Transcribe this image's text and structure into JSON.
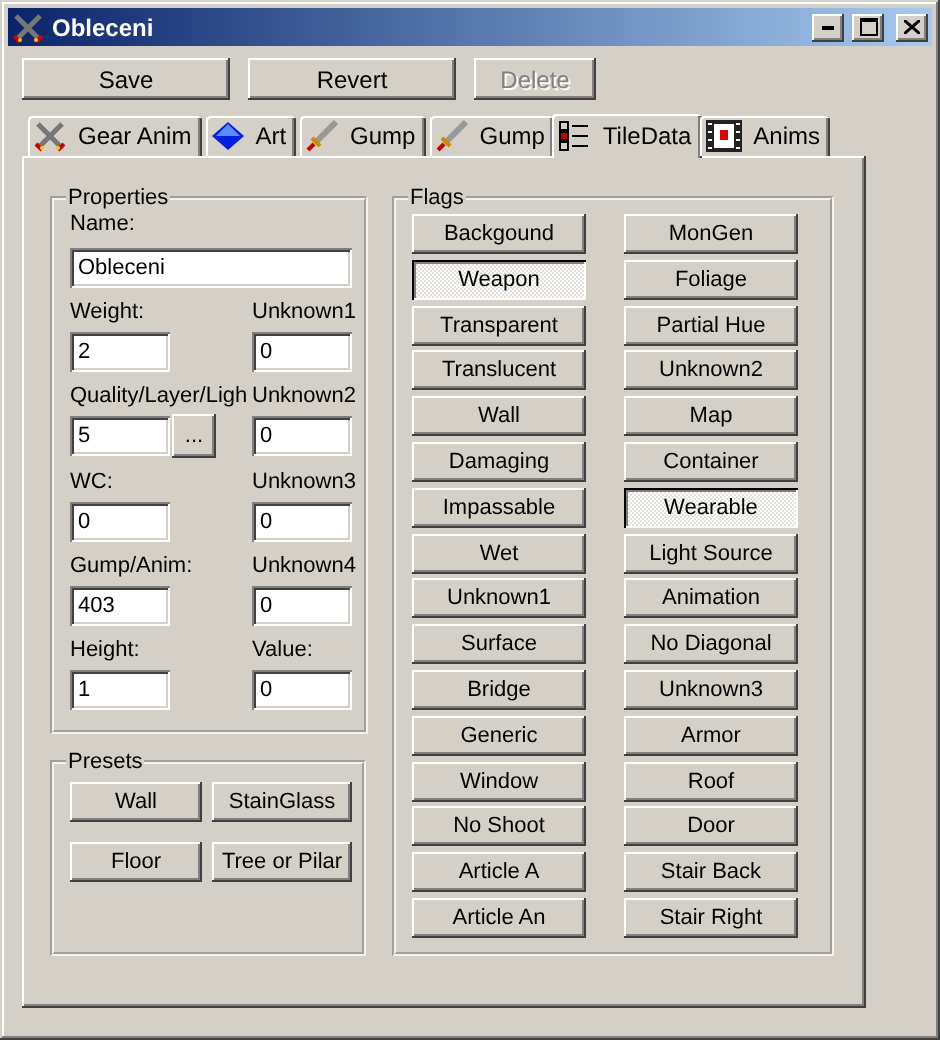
{
  "window": {
    "title": "Obleceni"
  },
  "toolbar": [
    {
      "label": "Save",
      "disabled": false
    },
    {
      "label": "Revert",
      "disabled": false
    },
    {
      "label": "Delete",
      "disabled": true
    }
  ],
  "tabs": [
    {
      "label": "Gear Anim",
      "kind": "swords",
      "selected": false
    },
    {
      "label": "Art",
      "kind": "gem",
      "selected": false
    },
    {
      "label": "Gump",
      "kind": "sword",
      "selected": false
    },
    {
      "label": "Gump",
      "kind": "sword",
      "selected": false
    },
    {
      "label": "TileData",
      "kind": "checklist",
      "selected": true
    },
    {
      "label": "Anims",
      "kind": "film",
      "selected": false
    }
  ],
  "properties": {
    "title": "Properties",
    "name": {
      "label": "Name:",
      "value": "Obleceni"
    },
    "rows": [
      {
        "left": {
          "label": "Weight:",
          "value": "2"
        },
        "right": {
          "label": "Unknown1",
          "value": "0"
        }
      },
      {
        "left": {
          "label": "Quality/Layer/Ligh",
          "value": "5",
          "button": "..."
        },
        "right": {
          "label": "Unknown2",
          "value": "0"
        }
      },
      {
        "left": {
          "label": "WC:",
          "value": "0"
        },
        "right": {
          "label": "Unknown3",
          "value": "0"
        }
      },
      {
        "left": {
          "label": "Gump/Anim:",
          "value": "403"
        },
        "right": {
          "label": "Unknown4",
          "value": "0"
        }
      },
      {
        "left": {
          "label": "Height:",
          "value": "1"
        },
        "right": {
          "label": "Value:",
          "value": "0"
        }
      }
    ]
  },
  "presets": {
    "title": "Presets",
    "buttons": [
      [
        "Wall",
        "StainGlass"
      ],
      [
        "Floor",
        "Tree or Pilar"
      ]
    ]
  },
  "flags": {
    "title": "Flags",
    "columns": [
      [
        {
          "label": "Backgound",
          "selected": false
        },
        {
          "label": "Weapon",
          "selected": true
        },
        {
          "label": "Transparent",
          "selected": false
        },
        {
          "label": "Translucent",
          "selected": false
        },
        {
          "label": "Wall",
          "selected": false
        },
        {
          "label": "Damaging",
          "selected": false
        },
        {
          "label": "Impassable",
          "selected": false
        },
        {
          "label": "Wet",
          "selected": false
        },
        {
          "label": "Unknown1",
          "selected": false
        },
        {
          "label": "Surface",
          "selected": false
        },
        {
          "label": "Bridge",
          "selected": false
        },
        {
          "label": "Generic",
          "selected": false
        },
        {
          "label": "Window",
          "selected": false
        },
        {
          "label": "No Shoot",
          "selected": false
        },
        {
          "label": "Article A",
          "selected": false
        },
        {
          "label": "Article An",
          "selected": false
        }
      ],
      [
        {
          "label": "MonGen",
          "selected": false
        },
        {
          "label": "Foliage",
          "selected": false
        },
        {
          "label": "Partial Hue",
          "selected": false
        },
        {
          "label": "Unknown2",
          "selected": false
        },
        {
          "label": "Map",
          "selected": false
        },
        {
          "label": "Container",
          "selected": false
        },
        {
          "label": "Wearable",
          "selected": true
        },
        {
          "label": "Light Source",
          "selected": false
        },
        {
          "label": "Animation",
          "selected": false
        },
        {
          "label": "No Diagonal",
          "selected": false
        },
        {
          "label": "Unknown3",
          "selected": false
        },
        {
          "label": "Armor",
          "selected": false
        },
        {
          "label": "Roof",
          "selected": false
        },
        {
          "label": "Door",
          "selected": false
        },
        {
          "label": "Stair Back",
          "selected": false
        },
        {
          "label": "Stair Right",
          "selected": false
        }
      ]
    ]
  }
}
